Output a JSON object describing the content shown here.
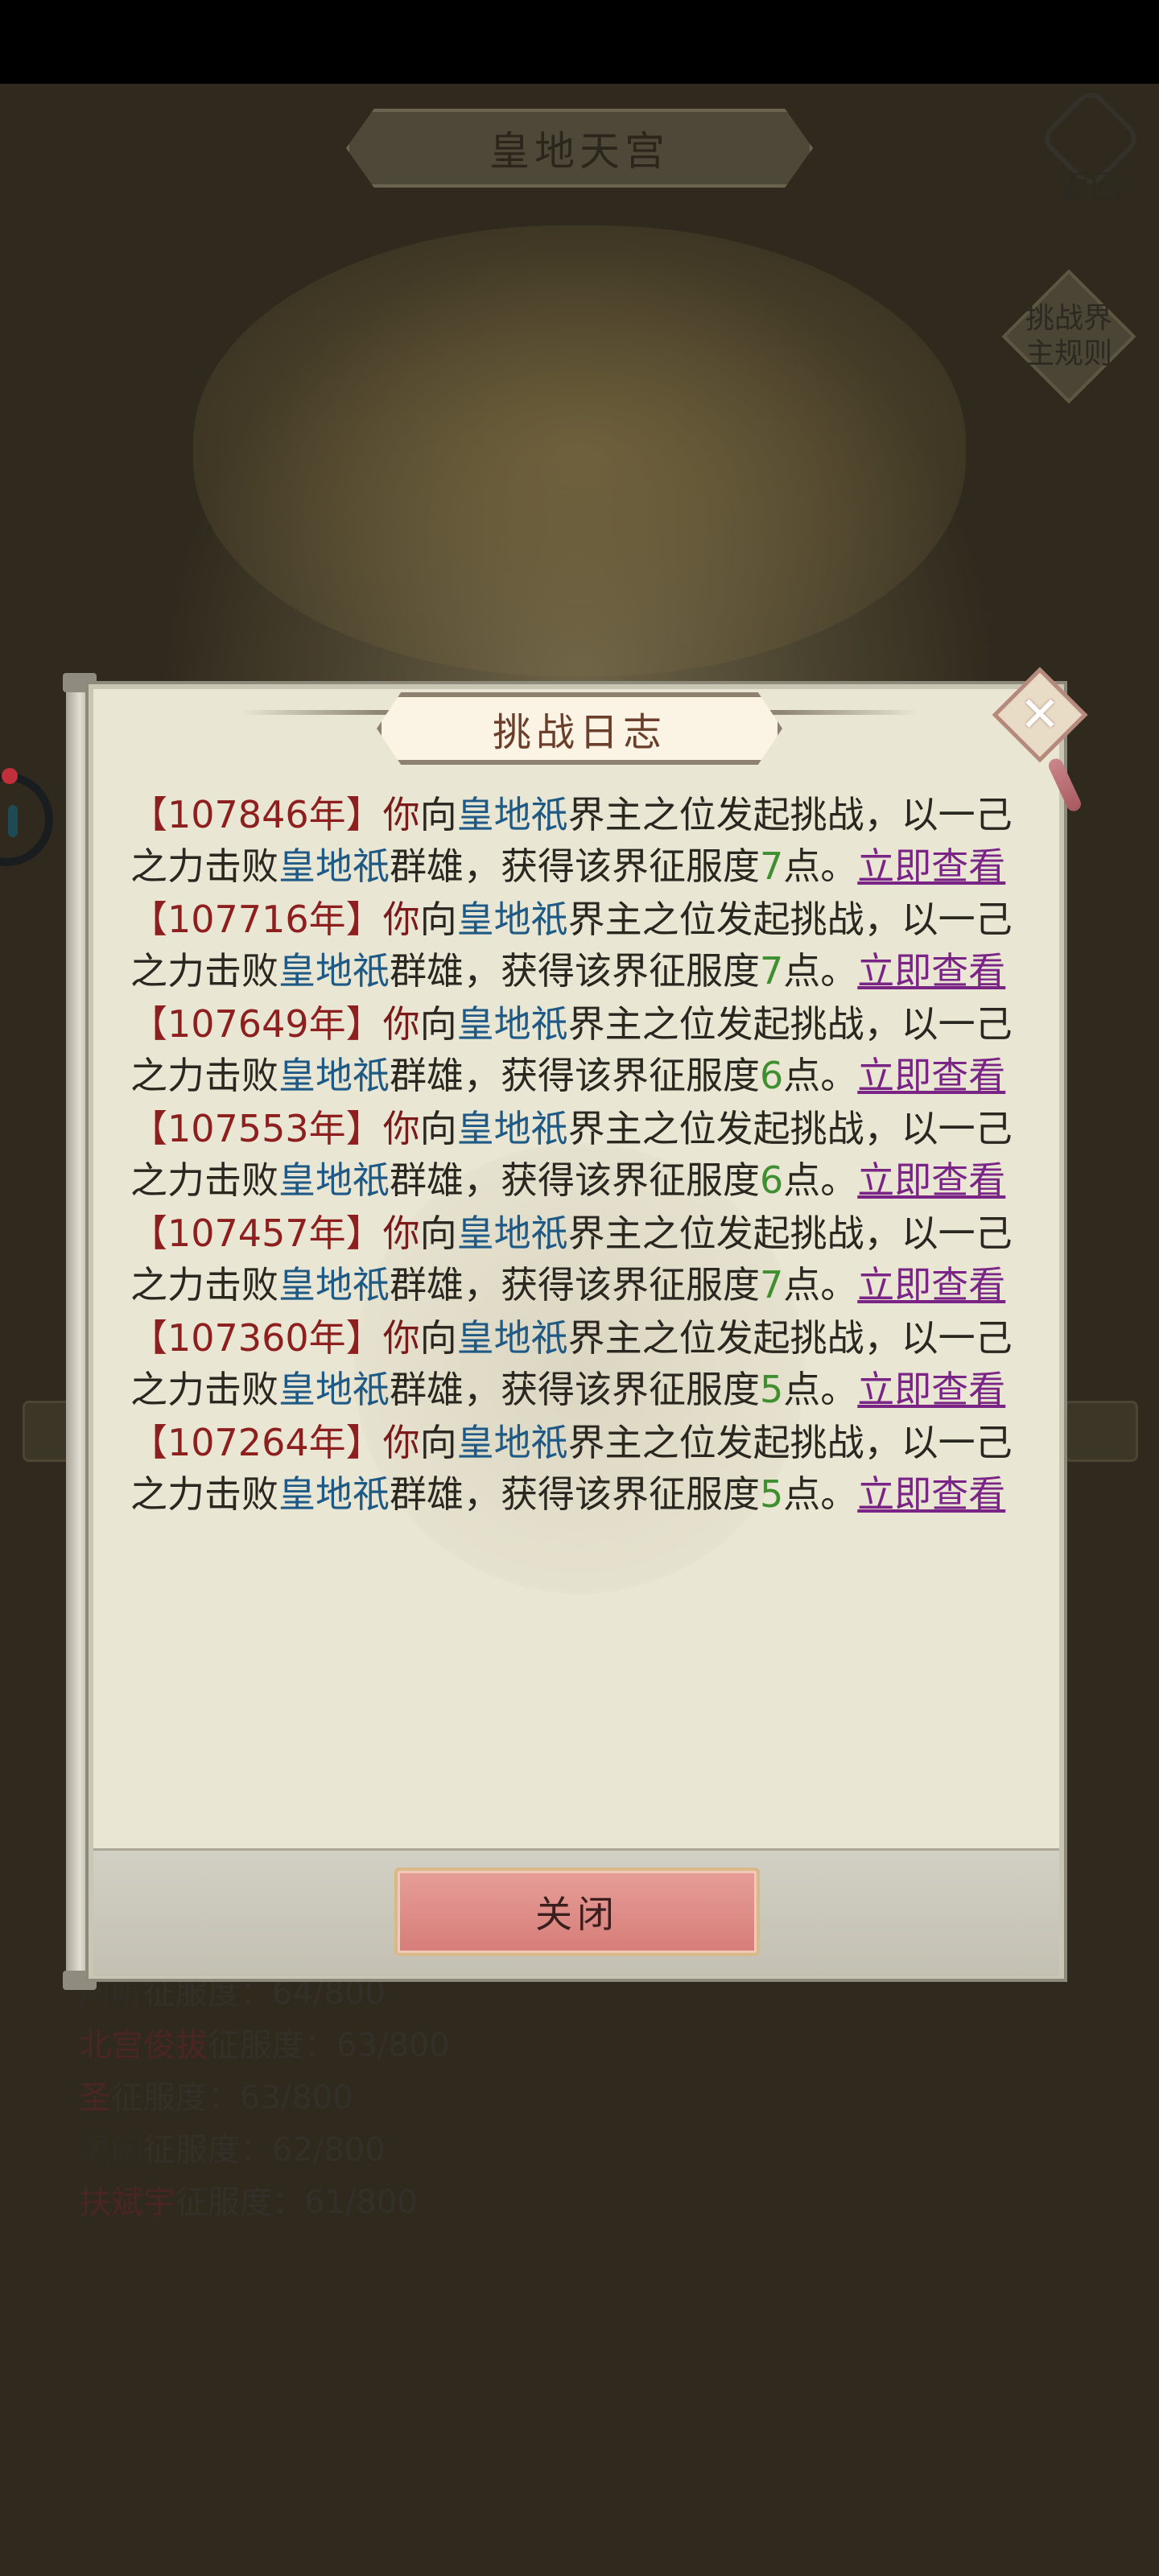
{
  "background": {
    "title": "皇地天宫",
    "back_label": "返回",
    "rules_label": "挑战界主规则",
    "rankings": [
      {
        "name": "冋昕",
        "suffix": "征服度：64/800",
        "red": false
      },
      {
        "name": "北宫俊拔",
        "suffix": "征服度：63/800",
        "red": true
      },
      {
        "name": "圣",
        "suffix": "征服度：63/800",
        "red": true
      },
      {
        "name": "风闲",
        "suffix": "征服度：62/800",
        "red": false
      },
      {
        "name": "扶斌宇",
        "suffix": "征服度：61/800",
        "red": true
      }
    ]
  },
  "modal": {
    "title": "挑战日志",
    "close_label": "关闭",
    "phrases": {
      "you": "你",
      "towards": "向",
      "challenge": "界主之位发起挑战，以一己之力击败",
      "heroes": "群雄，获得该界征服度",
      "points_suffix": "点。",
      "view_link": "立即查看"
    },
    "entries": [
      {
        "year": "【107846年】",
        "realm": "皇地祇",
        "points": "7"
      },
      {
        "year": "【107716年】",
        "realm": "皇地祇",
        "points": "7"
      },
      {
        "year": "【107649年】",
        "realm": "皇地祇",
        "points": "6"
      },
      {
        "year": "【107553年】",
        "realm": "皇地祇",
        "points": "6"
      },
      {
        "year": "【107457年】",
        "realm": "皇地祇",
        "points": "7"
      },
      {
        "year": "【107360年】",
        "realm": "皇地祇",
        "points": "5"
      },
      {
        "year": "【107264年】",
        "realm": "皇地祇",
        "points": "5"
      }
    ]
  },
  "colors": {
    "year": "#8d1f1f",
    "realm": "#1e5a85",
    "points": "#3f8f30",
    "link": "#7a2586"
  }
}
